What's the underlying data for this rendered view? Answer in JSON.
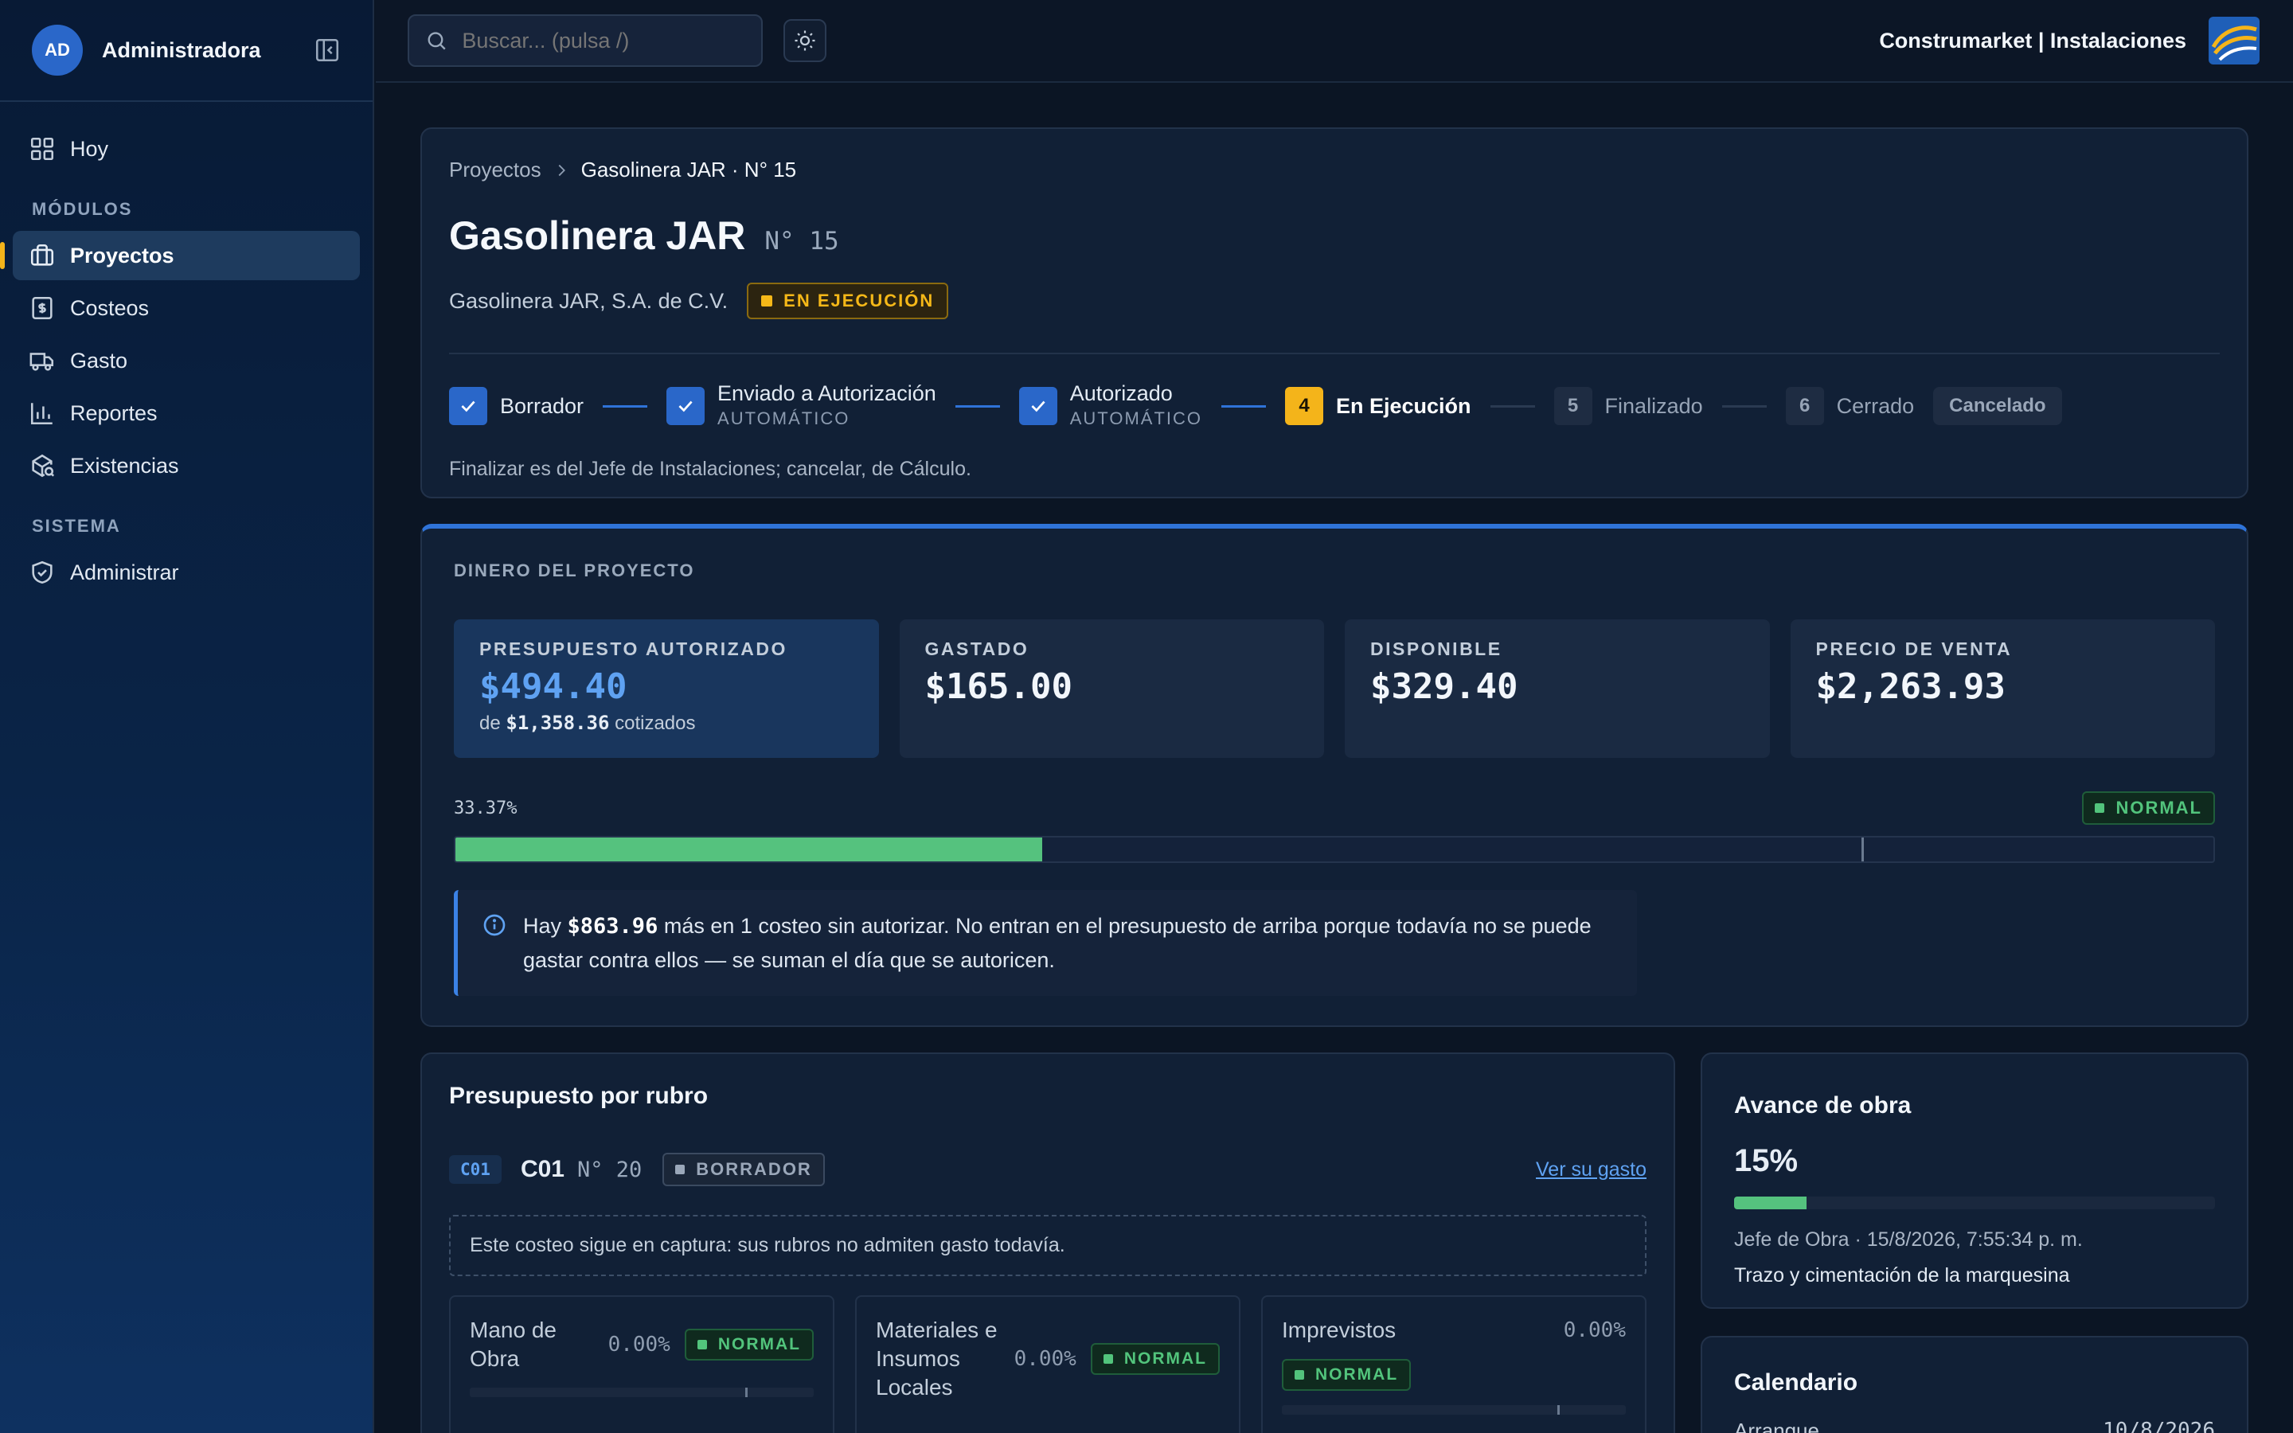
{
  "sidebar": {
    "avatar": "AD",
    "user": "Administradora",
    "items": [
      {
        "label": "Hoy"
      },
      {
        "label": "Proyectos"
      },
      {
        "label": "Costeos"
      },
      {
        "label": "Gasto"
      },
      {
        "label": "Reportes"
      },
      {
        "label": "Existencias"
      },
      {
        "label": "Administrar"
      }
    ],
    "sections": {
      "modulos": "MÓDULOS",
      "sistema": "SISTEMA"
    }
  },
  "topbar": {
    "search_placeholder": "Buscar... (pulsa /)",
    "brand": "Construmarket | Instalaciones"
  },
  "header": {
    "breadcrumb_root": "Proyectos",
    "breadcrumb_current": "Gasolinera JAR · N° 15",
    "title": "Gasolinera JAR",
    "number": "N° 15",
    "client": "Gasolinera JAR, S.A. de C.V.",
    "status": "EN EJECUCIÓN",
    "steps": [
      {
        "label": "Borrador",
        "state": "done"
      },
      {
        "label": "Enviado a Autorización",
        "sub": "AUTOMÁTICO",
        "state": "done"
      },
      {
        "label": "Autorizado",
        "sub": "AUTOMÁTICO",
        "state": "done"
      },
      {
        "label": "En Ejecución",
        "num": "4",
        "state": "current"
      },
      {
        "label": "Finalizado",
        "num": "5",
        "state": "pending"
      },
      {
        "label": "Cerrado",
        "num": "6",
        "state": "pending"
      }
    ],
    "cancel_label": "Cancelado",
    "note": "Finalizar es del Jefe de Instalaciones; cancelar, de Cálculo."
  },
  "money": {
    "section_label": "DINERO DEL PROYECTO",
    "kpis": [
      {
        "label": "PRESUPUESTO AUTORIZADO",
        "value": "$494.40",
        "sub_prefix": "de",
        "sub_value": "$1,358.36",
        "sub_suffix": "cotizados"
      },
      {
        "label": "GASTADO",
        "value": "$165.00"
      },
      {
        "label": "DISPONIBLE",
        "value": "$329.40"
      },
      {
        "label": "PRECIO DE VENTA",
        "value": "$2,263.93"
      }
    ],
    "percent_label": "33.37%",
    "percent": 33.37,
    "marker_percent": 80,
    "status": "NORMAL",
    "info_pre": "Hay",
    "info_amount": "$863.96",
    "info_post": "más en 1 costeo sin autorizar. No entran en el presupuesto de arriba porque todavía no se puede gastar contra ellos — se suman el día que se autoricen."
  },
  "rubro": {
    "title": "Presupuesto por rubro",
    "code": "C01",
    "name": "C01",
    "number": "N° 20",
    "status": "BORRADOR",
    "link": "Ver su gasto",
    "notice": "Este costeo sigue en captura: sus rubros no admiten gasto todavía.",
    "columns": [
      {
        "name": "Mano de Obra",
        "pct": "0.00%",
        "status": "NORMAL"
      },
      {
        "name": "Materiales e Insumos Locales",
        "pct": "0.00%",
        "status": "NORMAL"
      },
      {
        "name": "Imprevistos",
        "pct": "0.00%",
        "status": "NORMAL"
      }
    ]
  },
  "avance": {
    "title": "Avance de obra",
    "percent_label": "15%",
    "percent": 15,
    "meta": "Jefe de Obra · 15/8/2026, 7:55:34 p. m.",
    "desc": "Trazo y cimentación de la marquesina"
  },
  "calendario": {
    "title": "Calendario",
    "row_label": "Arranque",
    "row_value": "10/8/2026"
  },
  "colors": {
    "accent": "#2a67c9",
    "warning": "#f4b41a",
    "success": "#55c27e"
  }
}
